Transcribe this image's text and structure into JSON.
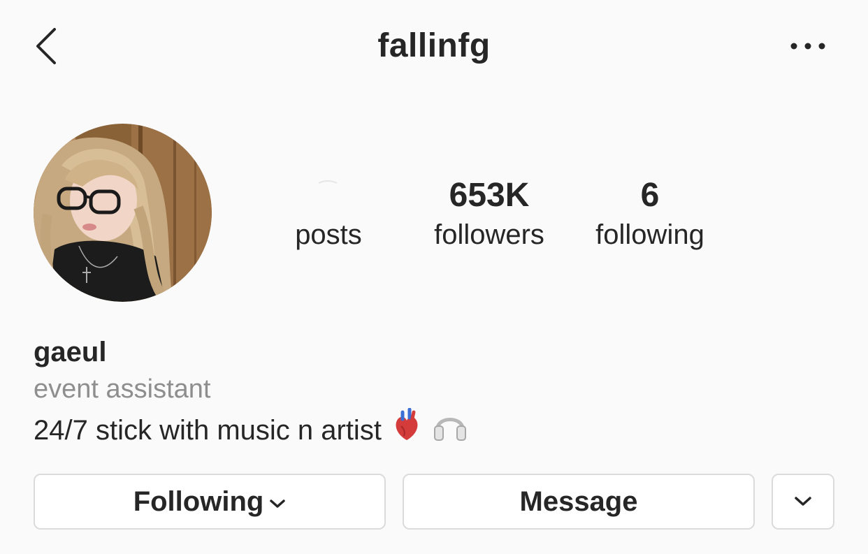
{
  "header": {
    "title": "fallinfg",
    "back_icon": "chevron-left-icon",
    "more_icon": "more-horizontal-icon"
  },
  "profile": {
    "avatar": "profile-photo",
    "stats": {
      "posts_label": "posts",
      "followers_count": "653K",
      "followers_label": "followers",
      "following_count": "6",
      "following_label": "following"
    }
  },
  "bio": {
    "name": "gaeul",
    "category": "event assistant",
    "text": "24/7 stick with music n artist",
    "emojis": [
      "anatomical-heart-icon",
      "headphones-icon"
    ]
  },
  "actions": {
    "following_label": "Following",
    "message_label": "Message",
    "suggest_icon": "chevron-down-icon"
  },
  "colors": {
    "background": "#fafafa",
    "text": "#262626",
    "secondary_text": "#8e8e8e",
    "button_border": "#dbdbdb"
  }
}
